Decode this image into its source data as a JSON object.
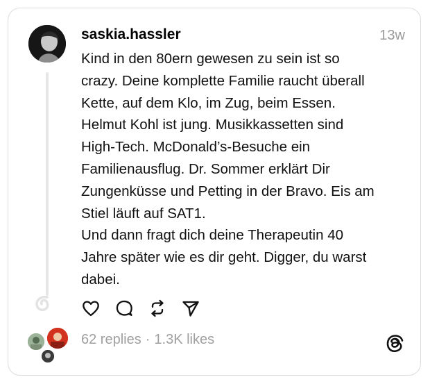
{
  "post": {
    "username": "saskia.hassler",
    "time": "13w",
    "lines": [
      "Kind in den 80ern gewesen zu sein ist so",
      "crazy. Deine komplette Familie raucht überall",
      "Kette, auf dem Klo, im Zug, beim Essen.",
      "Helmut Kohl ist jung. Musikkassetten sind",
      "High-Tech. McDonald’s-Besuche ein",
      "Familienausflug. Dr. Sommer erklärt Dir",
      "Zungenküsse und Petting in der Bravo. Eis am",
      "Stiel läuft auf SAT1.",
      "Und dann fragt dich deine Therapeutin 40",
      "Jahre später wie es dir geht. Digger, du warst",
      "dabei."
    ]
  },
  "actions": {
    "icons": [
      "heart-icon",
      "comment-icon",
      "repost-icon",
      "share-icon"
    ]
  },
  "stats": {
    "replies": "62 replies",
    "separator": "·",
    "likes": "1.3K likes"
  },
  "colors": {
    "text": "#111111",
    "muted": "#9a9a9a",
    "border": "#dcdcdc",
    "thread_line": "#e6e6e6"
  }
}
